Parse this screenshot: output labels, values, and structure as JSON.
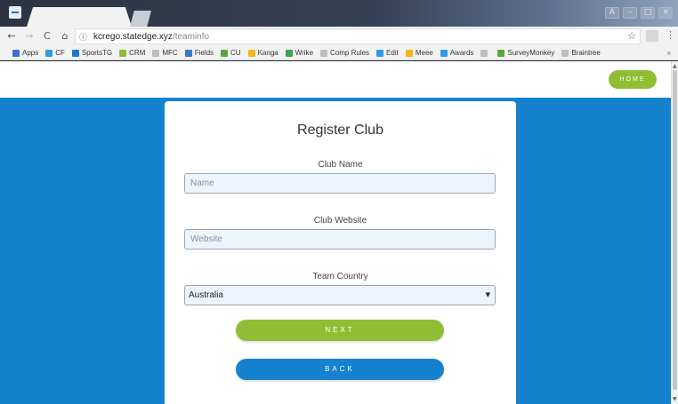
{
  "browser": {
    "window_controls": [
      "A",
      "–",
      "□",
      "×"
    ],
    "nav": {
      "back": "←",
      "forward": "→",
      "reload": "C",
      "home": "⌂"
    },
    "address": {
      "info_icon": "info-icon",
      "host": "kcrego.statedge.xyz",
      "path": "/teaminfo"
    },
    "star": "☆",
    "menu": "⋮",
    "bookmarks": [
      {
        "label": "Apps",
        "color": "#3b6fd4"
      },
      {
        "label": "CF",
        "color": "#2f9be0"
      },
      {
        "label": "SportsTG",
        "color": "#1e78c8"
      },
      {
        "label": "CRM",
        "color": "#8fbe34"
      },
      {
        "label": "MFC",
        "color": "#bdbdbd"
      },
      {
        "label": "Fields",
        "color": "#3a77c9"
      },
      {
        "label": "CU",
        "color": "#5aa83a"
      },
      {
        "label": "Kanga",
        "color": "#f2b51c"
      },
      {
        "label": "Wrike",
        "color": "#3aa54a"
      },
      {
        "label": "Comp Rules",
        "color": "#bdbdbd"
      },
      {
        "label": "Edit",
        "color": "#2f9be0"
      },
      {
        "label": "Meee",
        "color": "#f2b51c"
      },
      {
        "label": "Awards",
        "color": "#2f9be0"
      },
      {
        "label": "",
        "color": "#bdbdbd"
      },
      {
        "label": "SurveyMonkey",
        "color": "#5aa83a"
      },
      {
        "label": "Braintree",
        "color": "#bdbdbd"
      }
    ],
    "bookmarks_more": "»"
  },
  "header": {
    "home_label": "HOME"
  },
  "form": {
    "title": "Register Club",
    "club_name": {
      "label": "Club Name",
      "placeholder": "Name"
    },
    "club_website": {
      "label": "Club Website",
      "placeholder": "Website"
    },
    "team_country": {
      "label": "Team Country",
      "value": "Australia",
      "arrow": "▼"
    },
    "next_label": "NEXT",
    "back_label": "BACK"
  },
  "colors": {
    "accent_green": "#8fbe34",
    "primary_blue": "#1582d0",
    "input_bg": "#eef4fb"
  }
}
